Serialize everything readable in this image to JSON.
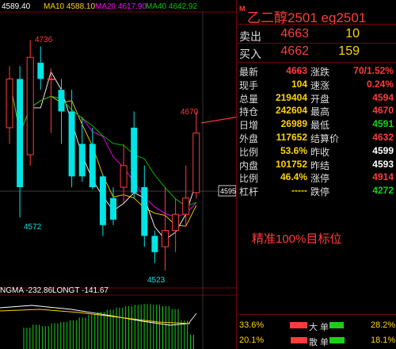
{
  "chart": {
    "legend": {
      "ma5": "4589.40",
      "ma10": "MA10 4588.10",
      "ma20": "MA20 4617.90",
      "ma40": "MA40 4642.92"
    },
    "price_labels": {
      "high": "4736",
      "left_low": "4572",
      "low": "4523",
      "last_high": "4670",
      "crosshair": "4595"
    },
    "indicator_legend": {
      "sigma": "NGMA -232.86",
      "longt": "LONGT -141.67"
    },
    "colors": {
      "up": "#ff3c3c",
      "down": "#00e5e5",
      "ma5": "#ffffff",
      "ma10": "#ffd400",
      "ma20": "#ff00ff",
      "ma40": "#00c800"
    },
    "candles": [
      {
        "o": 4655,
        "c": 4700,
        "h": 4712,
        "l": 4640
      },
      {
        "o": 4700,
        "c": 4600,
        "h": 4712,
        "l": 4572
      },
      {
        "o": 4630,
        "c": 4720,
        "h": 4736,
        "l": 4620
      },
      {
        "o": 4715,
        "c": 4700,
        "h": 4730,
        "l": 4690
      },
      {
        "o": 4700,
        "c": 4700,
        "h": 4710,
        "l": 4650
      },
      {
        "o": 4690,
        "c": 4670,
        "h": 4700,
        "l": 4640
      },
      {
        "o": 4670,
        "c": 4610,
        "h": 4690,
        "l": 4600
      },
      {
        "o": 4640,
        "c": 4610,
        "h": 4665,
        "l": 4605
      },
      {
        "o": 4640,
        "c": 4600,
        "h": 4655,
        "l": 4598
      },
      {
        "o": 4610,
        "c": 4565,
        "h": 4612,
        "l": 4555
      },
      {
        "o": 4590,
        "c": 4570,
        "h": 4600,
        "l": 4565
      },
      {
        "o": 4600,
        "c": 4620,
        "h": 4640,
        "l": 4585
      },
      {
        "o": 4655,
        "c": 4595,
        "h": 4670,
        "l": 4590
      },
      {
        "o": 4600,
        "c": 4555,
        "h": 4620,
        "l": 4545
      },
      {
        "o": 4555,
        "c": 4540,
        "h": 4560,
        "l": 4530
      },
      {
        "o": 4545,
        "c": 4560,
        "h": 4600,
        "l": 4523
      },
      {
        "o": 4560,
        "c": 4575,
        "h": 4590,
        "l": 4540
      },
      {
        "o": 4575,
        "c": 4590,
        "h": 4620,
        "l": 4565
      },
      {
        "o": 4595,
        "c": 4650,
        "h": 4670,
        "l": 4590
      }
    ]
  },
  "quote": {
    "header_badge": "M",
    "title": "乙二醇2501   eg2501",
    "ask": {
      "label": "卖出",
      "price": "4663",
      "volume": "10"
    },
    "bid": {
      "label": "买入",
      "price": "4662",
      "volume": "159"
    },
    "rows": [
      {
        "l1": "最新",
        "v1": "4663",
        "c1": "red",
        "l2": "涨跌",
        "v2": "70/1.52%",
        "c2": "red"
      },
      {
        "l1": "现手",
        "v1": "104",
        "c1": "yel",
        "l2": "速涨",
        "v2": "0.24%",
        "c2": "red"
      },
      {
        "l1": "总量",
        "v1": "219404",
        "c1": "yel",
        "l2": "开盘",
        "v2": "4594",
        "c2": "red"
      },
      {
        "l1": "持仓",
        "v1": "242604",
        "c1": "yel",
        "l2": "最高",
        "v2": "4670",
        "c2": "red"
      },
      {
        "l1": "日增",
        "v1": "26989",
        "c1": "yel",
        "l2": "最低",
        "v2": "4591",
        "c2": "grn"
      },
      {
        "l1": "外盘",
        "v1": "117652",
        "c1": "yel",
        "l2": "结算价",
        "v2": "4632",
        "c2": "red"
      },
      {
        "l1": "比例",
        "v1": "53.6%",
        "c1": "yel",
        "l2": "昨收",
        "v2": "4599",
        "c2": "wht"
      },
      {
        "l1": "内盘",
        "v1": "101752",
        "c1": "yel",
        "l2": "昨结",
        "v2": "4593",
        "c2": "wht"
      },
      {
        "l1": "比例",
        "v1": "46.4%",
        "c1": "yel",
        "l2": "涨停",
        "v2": "4914",
        "c2": "red"
      },
      {
        "l1": "杠杆",
        "v1": "-----",
        "c1": "yel",
        "l2": "跌停",
        "v2": "4272",
        "c2": "grn"
      }
    ],
    "annotation": "精准100%目标位",
    "flow": [
      {
        "left_pct": "33.6%",
        "label": "大 单",
        "right_pct": "28.2%",
        "bar_left": 0.55,
        "bar_right": 0.45
      },
      {
        "left_pct": "20.1%",
        "label": "散 单",
        "right_pct": "18.1%",
        "bar_left": 0.53,
        "bar_right": 0.47
      }
    ]
  }
}
